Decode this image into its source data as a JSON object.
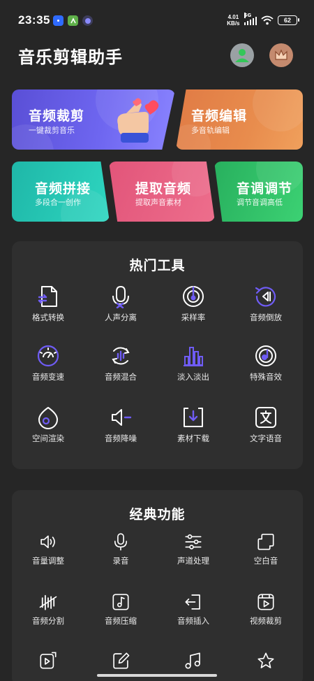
{
  "status_bar": {
    "time": "23:35",
    "net_speed_value": "4.01",
    "net_speed_unit": "KB/s",
    "network_type": "5G",
    "battery": "62"
  },
  "header": {
    "title": "音乐剪辑助手"
  },
  "feature_cards": {
    "trim": {
      "title": "音频裁剪",
      "subtitle": "一键裁剪音乐"
    },
    "edit": {
      "title": "音频编辑",
      "subtitle": "多音轨编辑"
    },
    "splice": {
      "title": "音频拼接",
      "subtitle": "多段合一创作"
    },
    "extract": {
      "title": "提取音频",
      "subtitle": "提取声音素材"
    },
    "pitch": {
      "title": "音调调节",
      "subtitle": "调节音调高低"
    }
  },
  "hot_tools": {
    "title": "热门工具",
    "items": [
      {
        "label": "格式转换",
        "icon": "format-convert-icon"
      },
      {
        "label": "人声分离",
        "icon": "vocal-separate-icon"
      },
      {
        "label": "采样率",
        "icon": "sample-rate-icon"
      },
      {
        "label": "音频倒放",
        "icon": "reverse-play-icon"
      },
      {
        "label": "音频变速",
        "icon": "speed-change-icon"
      },
      {
        "label": "音频混合",
        "icon": "audio-mix-icon"
      },
      {
        "label": "淡入淡出",
        "icon": "fade-in-out-icon"
      },
      {
        "label": "特殊音效",
        "icon": "special-effect-icon"
      },
      {
        "label": "空间渲染",
        "icon": "spatial-render-icon"
      },
      {
        "label": "音频降噪",
        "icon": "noise-reduce-icon"
      },
      {
        "label": "素材下载",
        "icon": "material-download-icon"
      },
      {
        "label": "文字语音",
        "icon": "text-to-speech-icon"
      }
    ]
  },
  "classic_features": {
    "title": "经典功能",
    "items": [
      {
        "label": "音量调整",
        "icon": "volume-icon"
      },
      {
        "label": "录音",
        "icon": "microphone-icon"
      },
      {
        "label": "声道处理",
        "icon": "channel-sliders-icon"
      },
      {
        "label": "空白音",
        "icon": "blank-sound-icon"
      },
      {
        "label": "音频分割",
        "icon": "audio-split-icon"
      },
      {
        "label": "音频压缩",
        "icon": "audio-compress-icon"
      },
      {
        "label": "音频插入",
        "icon": "audio-insert-icon"
      },
      {
        "label": "视频裁剪",
        "icon": "video-trim-icon"
      },
      {
        "label": "",
        "icon": "video-audio-icon"
      },
      {
        "label": "",
        "icon": "edit-pen-icon"
      },
      {
        "label": "",
        "icon": "music-note-icon"
      },
      {
        "label": "",
        "icon": "star-icon"
      }
    ]
  },
  "colors": {
    "background": "#262626",
    "panel": "#2f2f2f",
    "accent_purple": "#6f5cf5"
  }
}
